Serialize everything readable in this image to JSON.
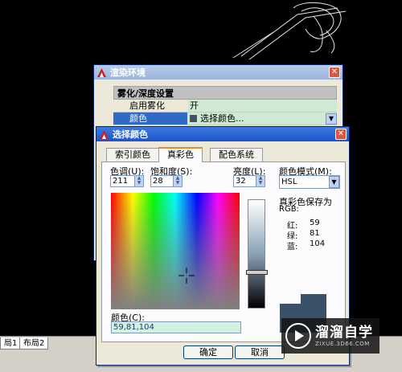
{
  "layout_tabs": [
    "局1",
    "布局2"
  ],
  "render_env": {
    "title": "渲染环境",
    "section": "雾化/深度设置",
    "rows": [
      {
        "name": "启用雾化",
        "value": "开"
      },
      {
        "name": "颜色",
        "value": "选择颜色..."
      }
    ]
  },
  "color_dialog": {
    "title": "选择颜色",
    "tabs": [
      "索引颜色",
      "真彩色",
      "配色系统"
    ],
    "active_tab": "真彩色",
    "hue_label": "色调(U):",
    "hue_value": "211",
    "sat_label": "饱和度(S):",
    "sat_value": "28",
    "lum_label": "亮度(L):",
    "lum_value": "32",
    "mode_label": "颜色模式(M):",
    "mode_value": "HSL",
    "saved_as_label": "真彩色保存为",
    "saved_as_mode": "RGB:",
    "rgb": [
      {
        "label": "红:",
        "value": "59"
      },
      {
        "label": "绿:",
        "value": "81"
      },
      {
        "label": "蓝:",
        "value": "104"
      }
    ],
    "color_label": "颜色(C):",
    "color_value": "59,81,104",
    "ok_label": "确定",
    "cancel_label": "取消",
    "current_color": "#3b5168"
  },
  "watermark": {
    "title": "溜溜自学",
    "url": "ZIXUE.3D66.COM"
  }
}
